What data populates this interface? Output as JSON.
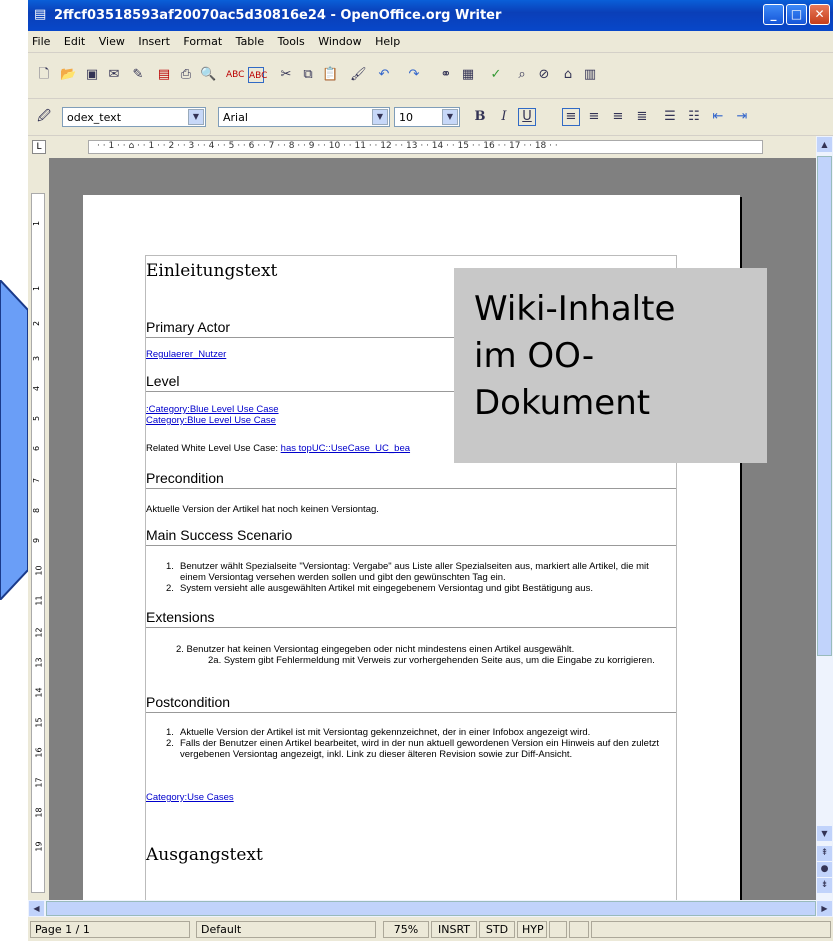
{
  "window": {
    "title": "2ffcf03518593af20070ac5d30816e24 - OpenOffice.org Writer"
  },
  "menu": [
    "File",
    "Edit",
    "View",
    "Insert",
    "Format",
    "Table",
    "Tools",
    "Window",
    "Help"
  ],
  "format_toolbar": {
    "style": "odex_text",
    "font": "Arial",
    "size": "10"
  },
  "ruler_text": "· · 1 · · ⌂ · · 1 · · 2 · · 3 · · 4 · · 5 · · 6 · · 7 · · 8 · · 9 · · 10 · · 11 · · 12 · · 13 · · 14 · · 15 · · 16 · · 17 · · 18 · ·",
  "vruler_numbers": [
    "1",
    "1",
    "2",
    "3",
    "4",
    "5",
    "6",
    "7",
    "8",
    "9",
    "10",
    "11",
    "12",
    "13",
    "14",
    "15",
    "16",
    "17",
    "18",
    "19"
  ],
  "doc": {
    "title1": "Einleitungstext",
    "primary_actor": "Primary Actor",
    "actor_link": "Regulaerer_Nutzer",
    "level": "Level",
    "level_link1": ":Category:Blue Level Use Case",
    "level_link2": "Category:Blue Level Use Case",
    "related_label": "Related White Level Use Case: ",
    "related_link": "has topUC::UseCase_UC_bea",
    "precondition": "Precondition",
    "precondition_text": "Aktuelle Version der Artikel hat noch keinen Versiontag.",
    "main_scenario": "Main Success Scenario",
    "main_items": [
      "Benutzer wählt Spezialseite \"Versiontag: Vergabe\" aus Liste aller Spezialseiten aus, markiert alle Artikel, die mit einem Versiontag versehen werden sollen und gibt den gewünschten Tag ein.",
      "System versieht alle ausgewählten Artikel mit eingegebenem Versiontag und gibt Bestätigung aus."
    ],
    "extensions": "Extensions",
    "ext_item": "2. Benutzer hat keinen Versiontag eingegeben oder nicht mindestens einen Artikel ausgewählt.",
    "ext_sub": "2a. System gibt Fehlermeldung mit Verweis zur vorhergehenden Seite aus, um die Eingabe zu korrigieren.",
    "postcondition": "Postcondition",
    "post_items": [
      "Aktuelle Version der Artikel ist mit Versiontag gekennzeichnet, der in einer Infobox angezeigt wird.",
      "Falls der Benutzer einen Artikel bearbeitet, wird in der nun aktuell gewordenen Version ein Hinweis auf den zuletzt vergebenen Versiontag angezeigt, inkl. Link zu dieser älteren Revision sowie zur Diff-Ansicht."
    ],
    "category_link": "Category:Use Cases",
    "title2": "Ausgangstext"
  },
  "overlay_text": [
    "Wiki-Inhalte",
    "im OO-",
    "Dokument"
  ],
  "status": {
    "page": "Page 1 / 1",
    "style": "Default",
    "zoom": "75%",
    "mode": "INSRT",
    "sel": "STD",
    "hyp": "HYP"
  }
}
